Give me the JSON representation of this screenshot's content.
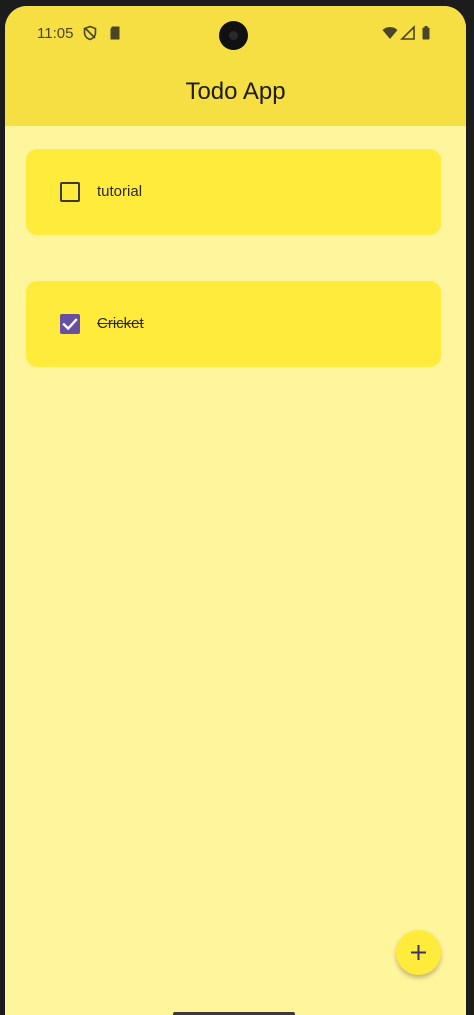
{
  "status_bar": {
    "time": "11:05",
    "left_icons": [
      "shield-icon",
      "sd-card-icon"
    ],
    "right_icons": [
      "wifi-icon",
      "signal-icon",
      "battery-icon"
    ]
  },
  "app_bar": {
    "title": "Todo App",
    "color": "#f5df43"
  },
  "todos": [
    {
      "label": "tutorial",
      "checked": false
    },
    {
      "label": "Cricket",
      "checked": true
    }
  ],
  "fab": {
    "icon": "plus-icon",
    "color": "#ffeb3b"
  },
  "colors": {
    "background": "#fff59d",
    "card": "#ffeb3b",
    "checkbox_checked": "#6750a4"
  }
}
